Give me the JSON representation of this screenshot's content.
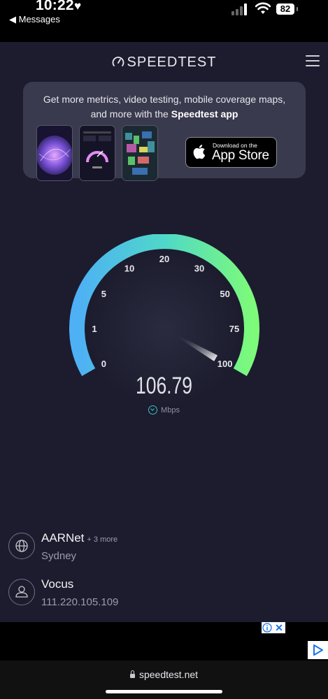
{
  "status_bar": {
    "time": "10:22",
    "heart": "♥",
    "back_label": "◀ Messages",
    "battery": "82"
  },
  "header": {
    "logo_text": "SPEEDTEST",
    "menu_icon": "hamburger-menu-icon"
  },
  "promo": {
    "line1": "Get more metrics, video testing, mobile coverage maps,",
    "line2_prefix": "and more with the ",
    "line2_bold": "Speedtest app",
    "store_small": "Download on the",
    "store_big": "App Store"
  },
  "gauge": {
    "ticks": [
      "0",
      "1",
      "5",
      "10",
      "20",
      "30",
      "50",
      "75",
      "100"
    ],
    "speed": "106.79",
    "unit": "Mbps",
    "needle_fraction": 1.0,
    "colors": {
      "start": "#4eb0f5",
      "mid": "#4fd8c8",
      "end": "#7dfa7a"
    }
  },
  "servers": [
    {
      "title": "AARNet",
      "more": "+ 3 more",
      "subtitle": "Sydney",
      "icon": "globe-icon"
    },
    {
      "title": "Vocus",
      "more": "",
      "subtitle": "111.220.105.109",
      "icon": "person-icon"
    }
  ],
  "browser": {
    "url": "speedtest.net"
  }
}
